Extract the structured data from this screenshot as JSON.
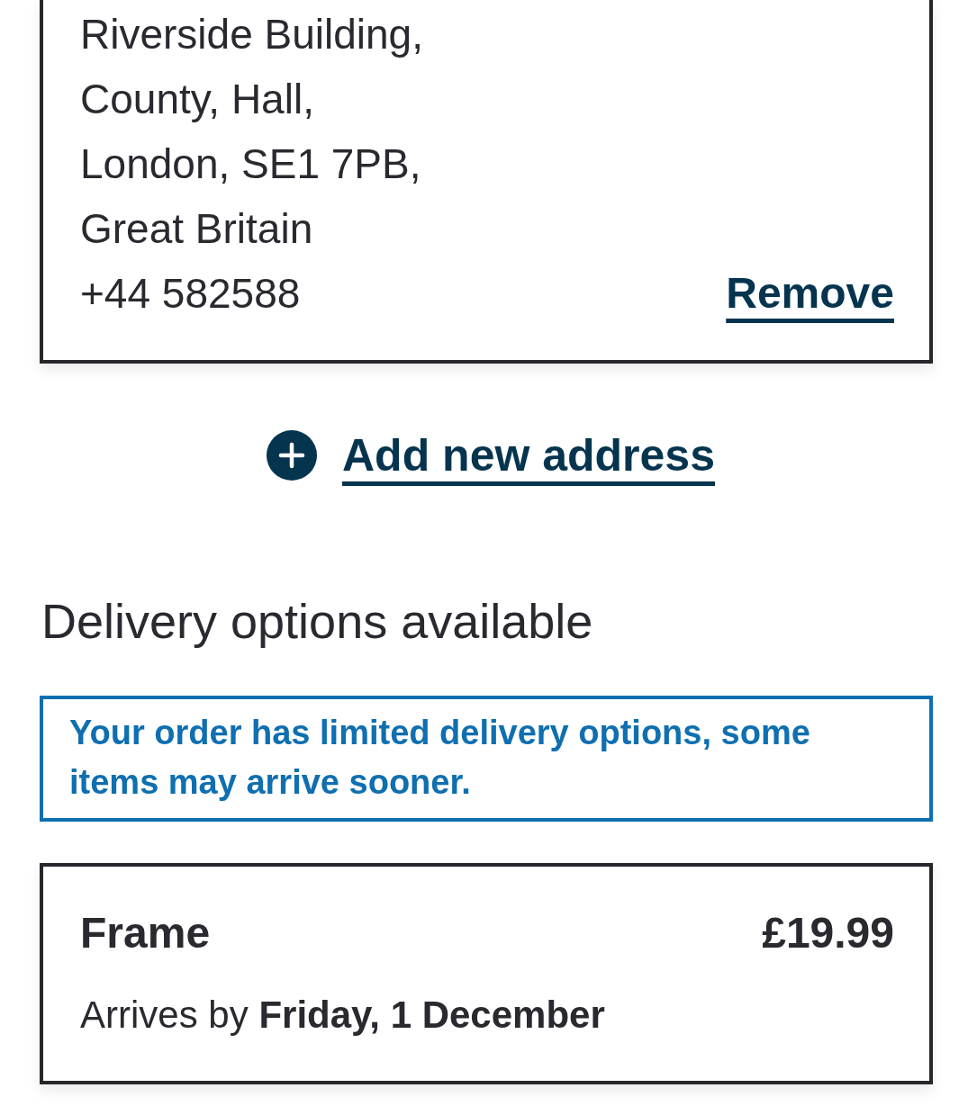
{
  "address_card": {
    "lines": [
      "Riverside Building,",
      "County, Hall,",
      "London, SE1 7PB,",
      "Great Britain"
    ],
    "phone": "+44 582588",
    "remove_link": "Remove"
  },
  "add_address": {
    "label": "Add new address"
  },
  "delivery": {
    "heading": "Delivery options available",
    "notice": "Your order has limited delivery options, some items may arrive sooner.",
    "options": [
      {
        "name": "Frame",
        "price": "£19.99",
        "arrival": "Arrives by **Friday, 1 December**"
      }
    ]
  }
}
